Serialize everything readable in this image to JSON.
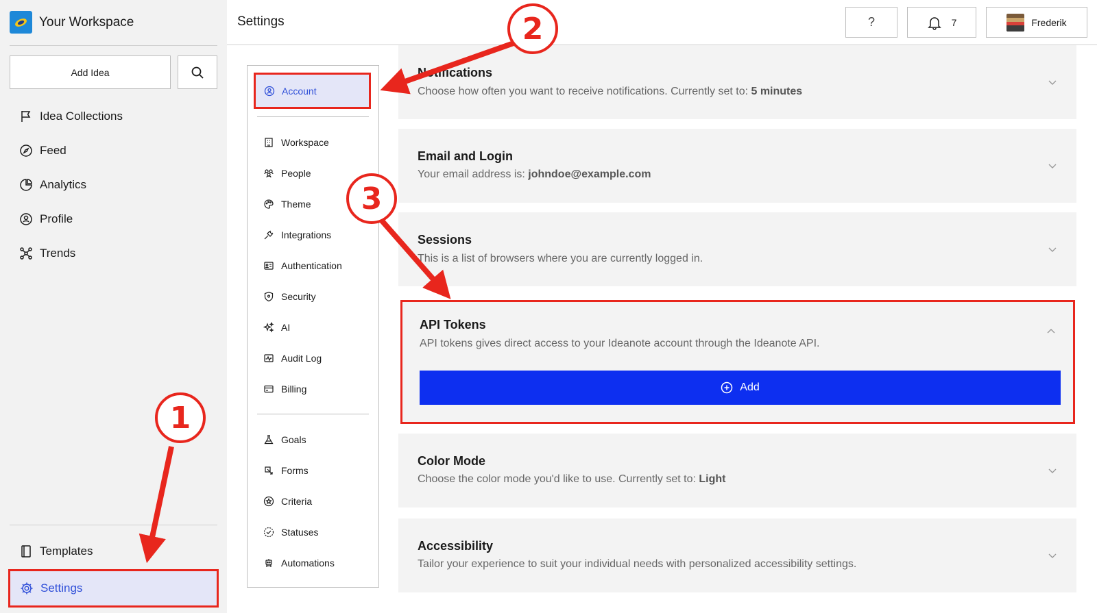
{
  "workspace": {
    "name": "Your Workspace"
  },
  "sidebar": {
    "add_idea_label": "Add Idea",
    "items": [
      {
        "label": "Idea Collections",
        "icon": "flag-icon"
      },
      {
        "label": "Feed",
        "icon": "compass-icon"
      },
      {
        "label": "Analytics",
        "icon": "pie-chart-icon"
      },
      {
        "label": "Profile",
        "icon": "user-circle-icon"
      },
      {
        "label": "Trends",
        "icon": "network-icon"
      }
    ],
    "templates_label": "Templates",
    "settings_label": "Settings"
  },
  "header": {
    "title": "Settings",
    "help_label": "?",
    "notification_count": "7",
    "user_name": "Frederik"
  },
  "settings_nav": {
    "active": "Account",
    "items": [
      "Workspace",
      "People",
      "Theme",
      "Integrations",
      "Authentication",
      "Security",
      "AI",
      "Audit Log",
      "Billing"
    ],
    "items2": [
      "Goals",
      "Forms",
      "Criteria",
      "Statuses",
      "Automations"
    ]
  },
  "panels": {
    "notifications": {
      "title": "Notifications",
      "desc": "Choose how often you want to receive notifications. Currently set to: ",
      "value": "5 minutes"
    },
    "email": {
      "title": "Email and Login",
      "desc": "Your email address is: ",
      "value": "johndoe@example.com"
    },
    "sessions": {
      "title": "Sessions",
      "desc": "This is a list of browsers where you are currently logged in."
    },
    "api": {
      "title": "API Tokens",
      "desc": "API tokens gives direct access to your Ideanote account through the Ideanote API.",
      "add_label": "Add"
    },
    "color_mode": {
      "title": "Color Mode",
      "desc": "Choose the color mode you'd like to use. Currently set to: ",
      "value": "Light"
    },
    "accessibility": {
      "title": "Accessibility",
      "desc": "Tailor your experience to suit your individual needs with personalized accessibility settings."
    }
  },
  "annotations": [
    "1",
    "2",
    "3"
  ],
  "colors": {
    "accent": "#2f4fd8",
    "primary_button": "#0d2ff0",
    "annotation_red": "#e8261d",
    "panel_bg": "#f3f3f3"
  }
}
